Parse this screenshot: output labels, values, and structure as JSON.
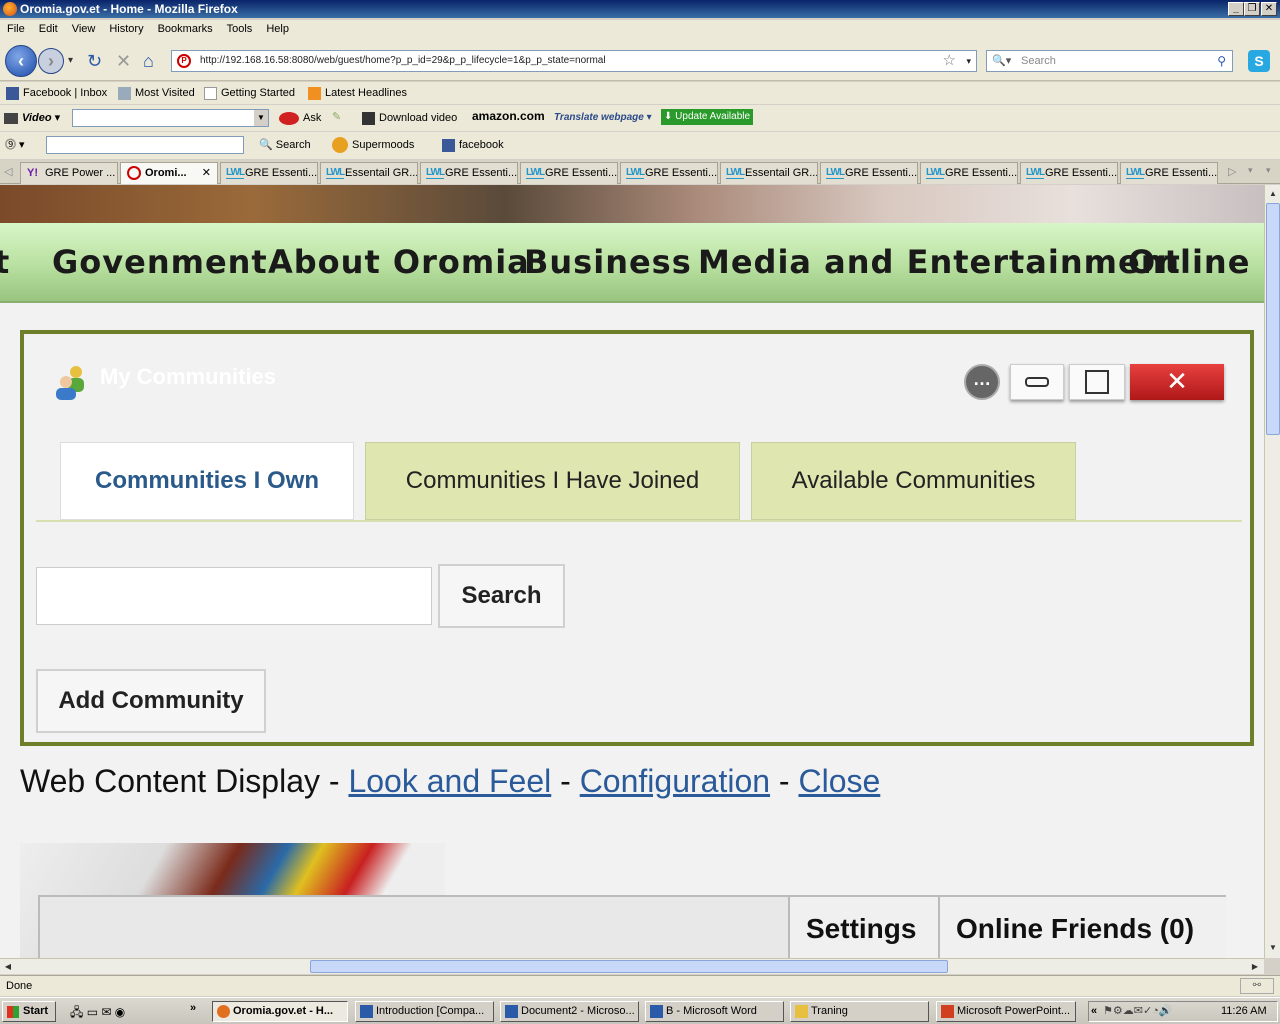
{
  "window": {
    "title": "Oromia.gov.et - Home - Mozilla Firefox"
  },
  "menu": [
    "File",
    "Edit",
    "View",
    "History",
    "Bookmarks",
    "Tools",
    "Help"
  ],
  "nav": {
    "url": "http://192.168.16.58:8080/web/guest/home?p_p_id=29&p_p_lifecycle=1&p_p_state=normal",
    "search_placeholder": "Search"
  },
  "bookmarks": [
    "Facebook | Inbox",
    "Most Visited",
    "Getting Started",
    "Latest Headlines"
  ],
  "toolbar2": {
    "video": "Video",
    "ask": "Ask",
    "download": "Download video",
    "amazon": "amazon.com",
    "translate": "Translate webpage",
    "update": "Update Available"
  },
  "toolbar3": {
    "search": "Search",
    "supermoods": "Supermoods",
    "facebook": "facebook"
  },
  "tabs": [
    {
      "label": "GRE Power ...",
      "icon": "yahoo"
    },
    {
      "label": "Oromi...",
      "icon": "oromia",
      "active": true
    },
    {
      "label": "GRE Essenti...",
      "icon": "lwl"
    },
    {
      "label": "Essentail GR...",
      "icon": "lwl"
    },
    {
      "label": "GRE Essenti...",
      "icon": "lwl"
    },
    {
      "label": "GRE Essenti...",
      "icon": "lwl"
    },
    {
      "label": "GRE Essenti...",
      "icon": "lwl"
    },
    {
      "label": "Essentail GR...",
      "icon": "lwl"
    },
    {
      "label": "GRE Essenti...",
      "icon": "lwl"
    },
    {
      "label": "GRE Essenti...",
      "icon": "lwl"
    },
    {
      "label": "GRE Essenti...",
      "icon": "lwl"
    },
    {
      "label": "GRE Essenti...",
      "icon": "lwl"
    }
  ],
  "site_nav": [
    "t",
    "Govenment",
    "About Oromia",
    "Business",
    "Media and Entertainment",
    "Online Se"
  ],
  "portlet": {
    "title": "My Communities",
    "tabs": [
      "Communities I Own",
      "Communities I Have Joined",
      "Available Communities"
    ],
    "search_value": "",
    "search_button": "Search",
    "add_button": "Add Community"
  },
  "wcd": {
    "label": "Web Content Display",
    "sep": "-",
    "links": [
      "Look and Feel",
      "Configuration",
      "Close"
    ]
  },
  "dock": {
    "settings": "Settings",
    "friends": "Online Friends (0)"
  },
  "status": "Done",
  "taskbar": {
    "start": "Start",
    "buttons": [
      "Oromia.gov.et - H...",
      "Introduction [Compa...",
      "Document2 - Microso...",
      "B - Microsoft Word",
      "Traning",
      "Microsoft PowerPoint..."
    ],
    "time": "11:26 AM"
  },
  "colors": {
    "portlet_border": "#6e7f2a",
    "tab_inactive": "#dfe6b0",
    "nav_green": "#b8e0a0",
    "link": "#2a5a9a",
    "close_red": "#d02020"
  }
}
